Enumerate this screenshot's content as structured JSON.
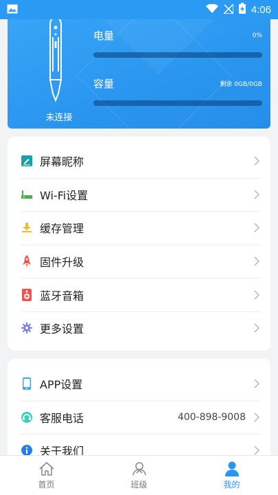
{
  "status_bar": {
    "time": "4:06",
    "icons": [
      "image-icon",
      "wifi-icon",
      "no-signal-icon",
      "battery-charging-icon"
    ]
  },
  "device": {
    "connection_status": "未连接",
    "battery": {
      "label": "电量",
      "value_text": "0%",
      "level": 0
    },
    "capacity": {
      "label": "容量",
      "value_text": "剩余 0GB/0GB",
      "level": 0
    }
  },
  "settings_menu": {
    "items": [
      {
        "label": "屏幕昵称",
        "icon": "pencil-screen-icon"
      },
      {
        "label": "Wi-Fi设置",
        "icon": "router-icon"
      },
      {
        "label": "缓存管理",
        "icon": "download-icon"
      },
      {
        "label": "固件升级",
        "icon": "rocket-icon"
      },
      {
        "label": "蓝牙音箱",
        "icon": "speaker-icon"
      },
      {
        "label": "更多设置",
        "icon": "gear-icon"
      }
    ]
  },
  "app_menu": {
    "items": [
      {
        "label": "APP设置",
        "icon": "phone-icon"
      },
      {
        "label": "客服电话",
        "icon": "headset-icon",
        "value": "400-898-9008"
      },
      {
        "label": "关于我们",
        "icon": "info-icon"
      }
    ]
  },
  "bottom_nav": {
    "items": [
      {
        "label": "首页",
        "icon": "home-icon"
      },
      {
        "label": "班级",
        "icon": "class-icon"
      },
      {
        "label": "我的",
        "icon": "user-icon",
        "active": true
      }
    ]
  },
  "colors": {
    "accent": "#2a96f0",
    "icon_teal": "#1aa0a8",
    "icon_green": "#4caf50",
    "icon_yellow": "#f5b829",
    "icon_red": "#ef5350",
    "icon_purple": "#7b7fe6",
    "icon_blue": "#42a5f5",
    "icon_cyan": "#3ccfb9"
  }
}
